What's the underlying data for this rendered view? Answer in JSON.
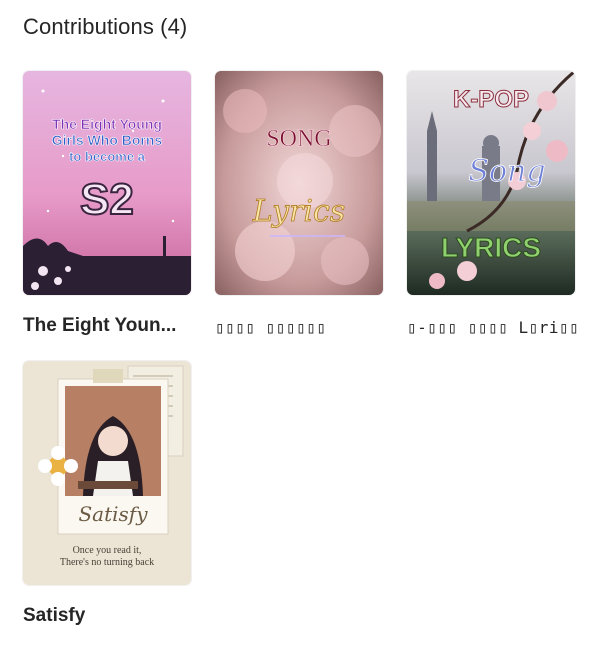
{
  "section": {
    "title": "Contributions (4)"
  },
  "books": [
    {
      "title": "The Eight Youn...",
      "cover_text": [
        "The Eight Young",
        "Girls Who Borns",
        "to become a",
        "S2"
      ]
    },
    {
      "title": "▯▯▯▯ ▯▯▯▯▯▯",
      "cover_text": [
        "SONG",
        "Lyrics"
      ]
    },
    {
      "title": "▯-▯▯▯ ▯▯▯▯ L▯ri▯▯",
      "cover_text": [
        "K-POP",
        "Song",
        "LYRICS"
      ]
    },
    {
      "title": "Satisfy",
      "cover_text": [
        "Satisfy",
        "Once you read it,",
        "There's no turning back"
      ]
    }
  ]
}
